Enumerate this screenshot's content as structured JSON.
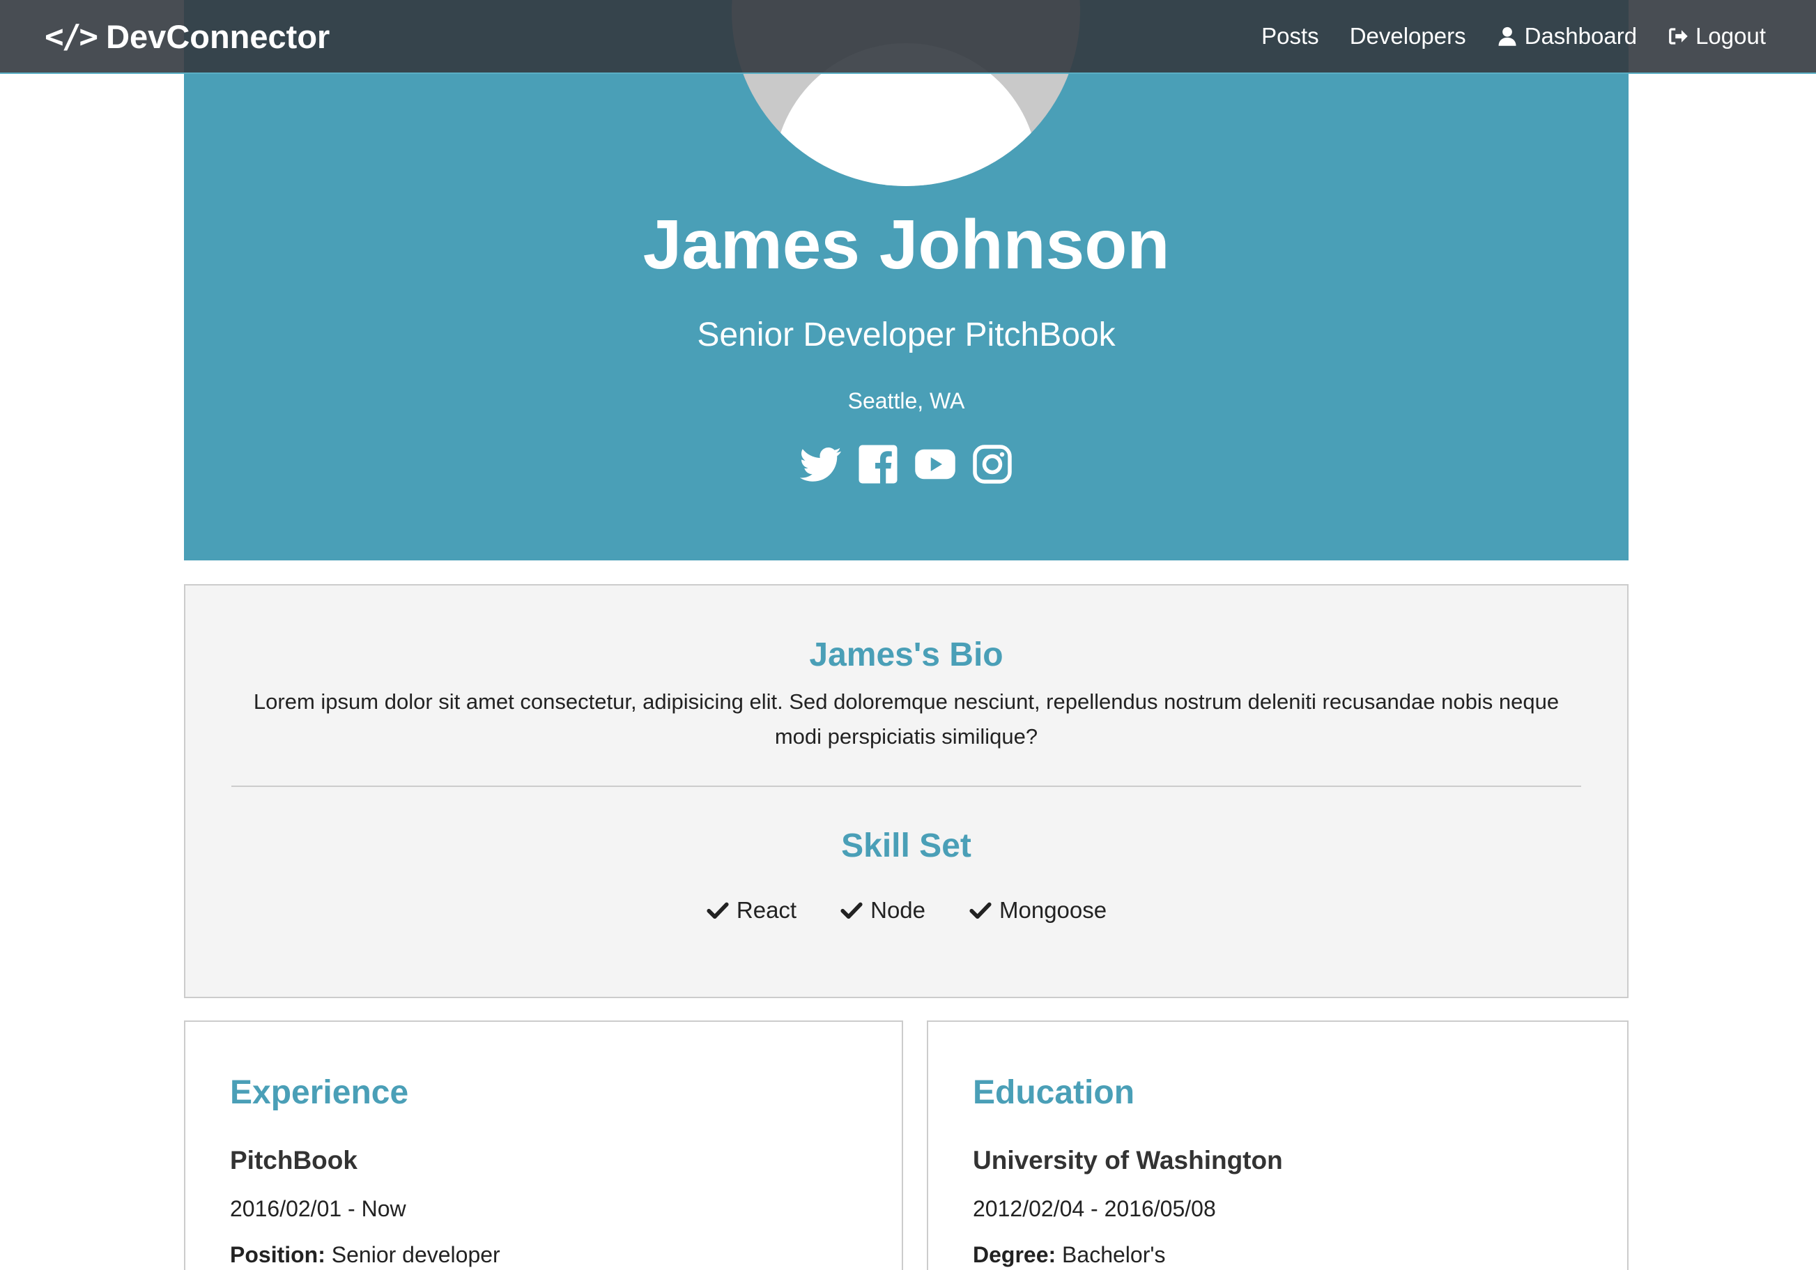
{
  "nav": {
    "brand": "DevConnector",
    "brand_icon": "code-icon",
    "links": [
      {
        "label": "Posts"
      },
      {
        "label": "Developers"
      },
      {
        "label": "Dashboard",
        "icon": "user-icon"
      },
      {
        "label": "Logout",
        "icon": "sign-out-icon"
      }
    ]
  },
  "profile": {
    "name": "James Johnson",
    "title": "Senior Developer PitchBook",
    "location": "Seattle, WA",
    "socials": [
      "twitter-icon",
      "facebook-icon",
      "youtube-icon",
      "instagram-icon"
    ]
  },
  "bio": {
    "heading": "James's Bio",
    "text": "Lorem ipsum dolor sit amet consectetur, adipisicing elit. Sed doloremque nesciunt, repellendus nostrum deleniti recusandae nobis neque modi perspiciatis similique?"
  },
  "skills": {
    "heading": "Skill Set",
    "items": [
      "React",
      "Node",
      "Mongoose"
    ]
  },
  "experience": {
    "heading": "Experience",
    "company": "PitchBook",
    "dates": "2016/02/01 - Now",
    "position_label": "Position:",
    "position": "Senior developer"
  },
  "education": {
    "heading": "Education",
    "school": "University of Washington",
    "dates": "2012/02/04 - 2016/05/08",
    "degree_label": "Degree:",
    "degree": "Bachelor's"
  },
  "colors": {
    "primary": "#4a9fb7",
    "navbar": "#343a40",
    "light_bg": "#f4f4f4",
    "border": "#cccccc"
  }
}
